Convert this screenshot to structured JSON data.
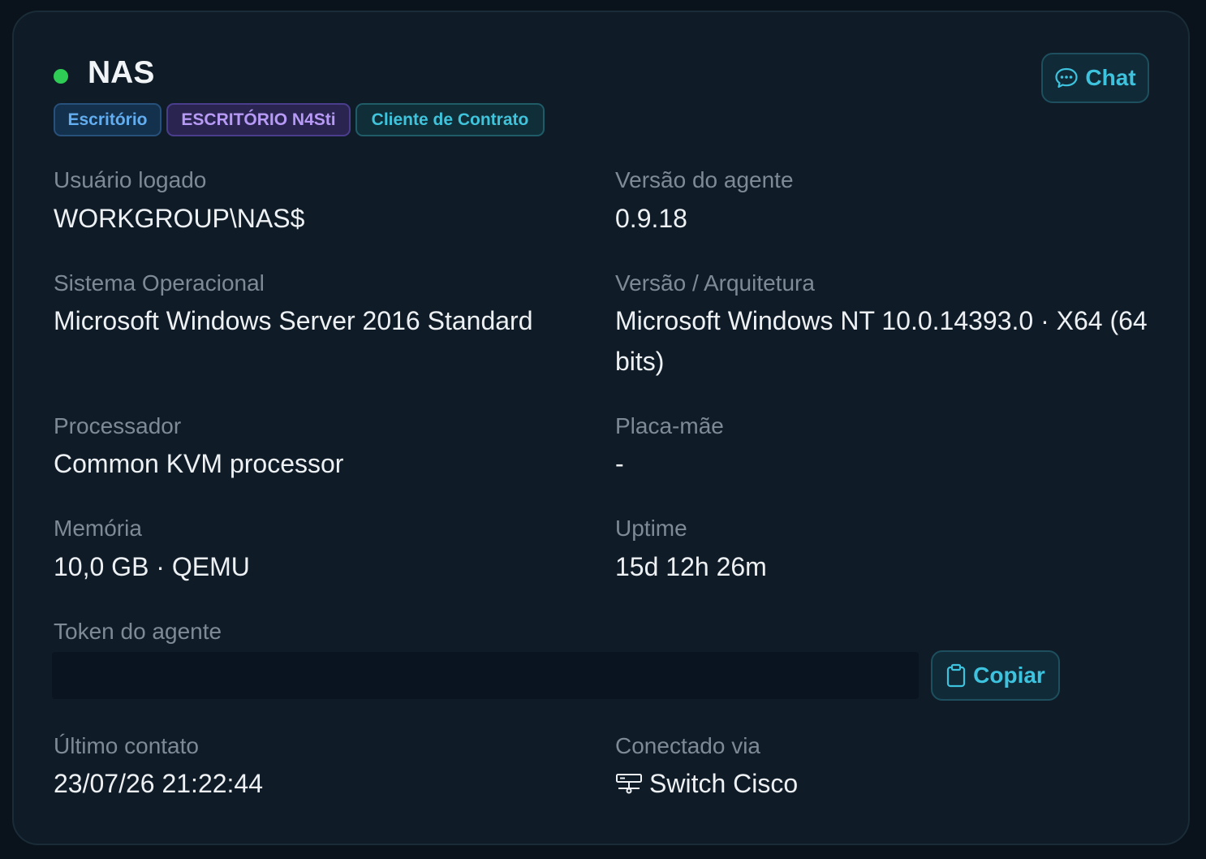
{
  "device": {
    "name": "NAS",
    "status_color": "#2ecc55"
  },
  "header": {
    "chat_label": "Chat",
    "chat_icon": "chat-bubble-icon"
  },
  "tags": [
    {
      "label": "Escritório",
      "color": "#63aef0"
    },
    {
      "label": "ESCRITÓRIO N4Sti",
      "color": "#b79af5"
    },
    {
      "label": "Cliente de Contrato",
      "color": "#3fc4dc"
    }
  ],
  "fields": {
    "logged_user": {
      "label": "Usuário logado",
      "value": "WORKGROUP\\NAS$"
    },
    "agent_version": {
      "label": "Versão do agente",
      "value": "0.9.18"
    },
    "os": {
      "label": "Sistema Operacional",
      "value": "Microsoft Windows Server 2016 Standard"
    },
    "version_arch": {
      "label": "Versão / Arquitetura",
      "value": "Microsoft Windows NT 10.0.14393.0 · X64 (64 bits)"
    },
    "processor": {
      "label": "Processador",
      "value": "Common KVM processor"
    },
    "motherboard": {
      "label": "Placa-mãe",
      "value": "-"
    },
    "memory": {
      "label": "Memória",
      "value": "10,0 GB · QEMU"
    },
    "uptime": {
      "label": "Uptime",
      "value": "15d 12h 26m"
    },
    "token": {
      "label": "Token do agente",
      "value": "",
      "copy_label": "Copiar",
      "copy_icon": "clipboard-icon"
    },
    "last_contact": {
      "label": "Último contato",
      "value": "23/07/26 21:22:44"
    },
    "connected_via": {
      "label": "Conectado via",
      "value": "Switch Cisco",
      "icon": "network-switch-icon"
    }
  }
}
